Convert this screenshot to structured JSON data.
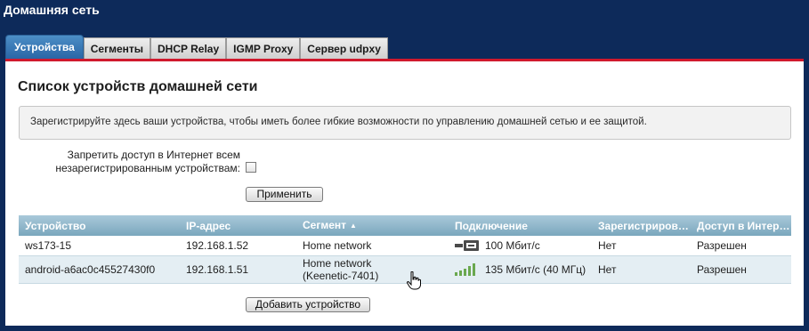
{
  "app": {
    "title": "Домашняя сеть"
  },
  "tabs": [
    {
      "label": "Устройства",
      "active": true
    },
    {
      "label": "Сегменты"
    },
    {
      "label": "DHCP Relay"
    },
    {
      "label": "IGMP Proxy"
    },
    {
      "label": "Сервер udpxy"
    }
  ],
  "section": {
    "title": "Список устройств домашней сети",
    "info": "Зарегистрируйте здесь ваши устройства, чтобы иметь более гибкие возможности по управлению домашней сетью и ее защитой."
  },
  "deny": {
    "label_line1": "Запретить доступ в Интернет всем",
    "label_line2": "незарегистрированным устройствам:",
    "checked": false
  },
  "buttons": {
    "apply": "Применить",
    "add_device": "Добавить устройство"
  },
  "table": {
    "columns": [
      "Устройство",
      "IP-адрес",
      "Сегмент",
      "Подключение",
      "Зарегистриров…",
      "Доступ в Интер…"
    ],
    "sort_indicator": "▲",
    "rows": [
      {
        "device": "ws173-15",
        "ip": "192.168.1.52",
        "segment": "Home network",
        "segment2": "",
        "connection_icon": "ethernet-icon",
        "connection": "100 Мбит/с",
        "registered": "Нет",
        "access": "Разрешен"
      },
      {
        "device": "android-a6ac0c45527430f0",
        "ip": "192.168.1.51",
        "segment": "Home network",
        "segment2": "(Keenetic-7401)",
        "connection_icon": "wifi-signal-icon",
        "connection": "135 Мбит/с (40 МГц)",
        "registered": "Нет",
        "access": "Разрешен"
      }
    ]
  },
  "colors": {
    "page_bg": "#0d2a5a",
    "accent_red": "#d0192d",
    "active_tab": "#2a66a6",
    "table_header": "#7aa7bd",
    "signal_green": "#6aa84f"
  }
}
